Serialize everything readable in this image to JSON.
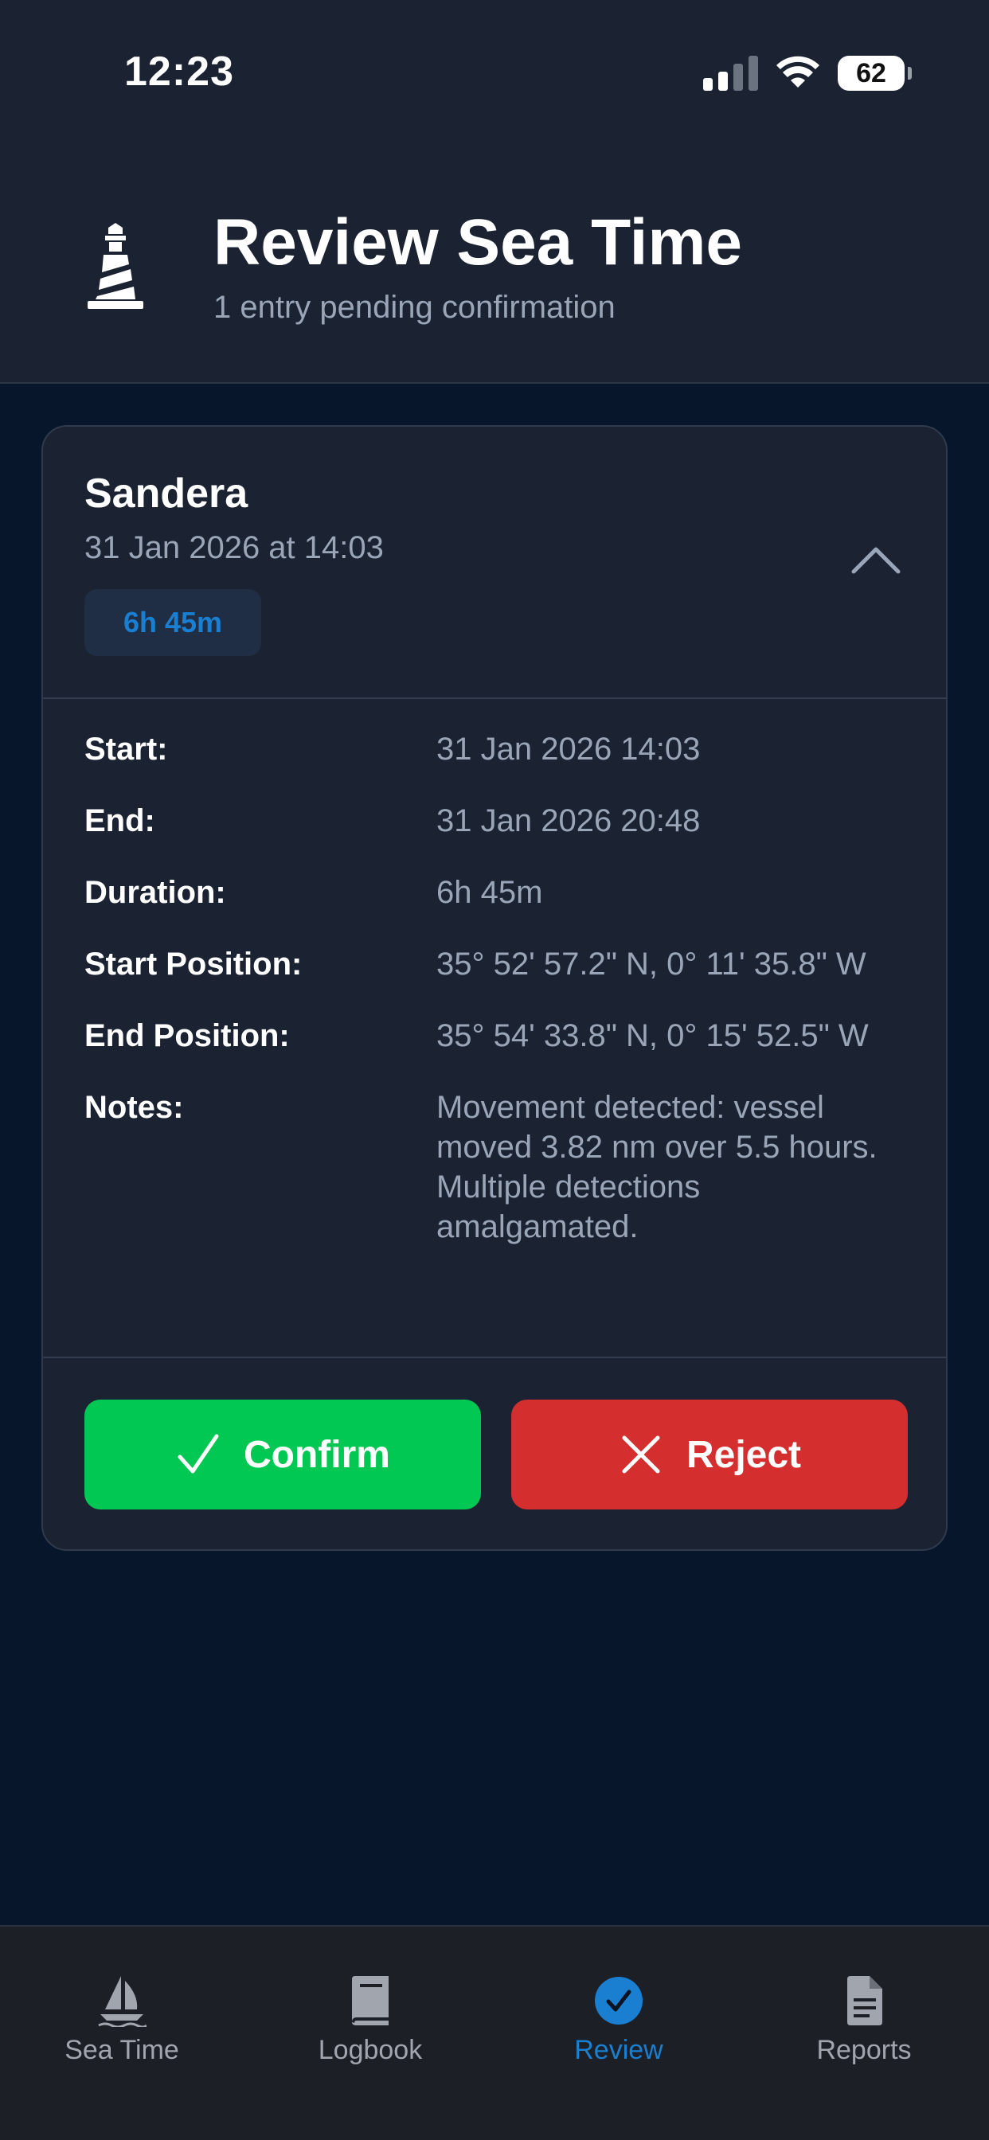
{
  "status_bar": {
    "time": "12:23",
    "battery": "62"
  },
  "header": {
    "title": "Review Sea Time",
    "subtitle": "1 entry pending confirmation"
  },
  "entry": {
    "vessel": "Sandera",
    "date": "31 Jan 2026 at 14:03",
    "duration_badge": "6h 45m",
    "details": [
      {
        "label": "Start:",
        "value": "31 Jan 2026 14:03"
      },
      {
        "label": "End:",
        "value": "31 Jan 2026 20:48"
      },
      {
        "label": "Duration:",
        "value": "6h 45m"
      },
      {
        "label": "Start Position:",
        "value": "35° 52' 57.2\" N, 0° 11' 35.8\" W"
      },
      {
        "label": "End Position:",
        "value": "35° 54' 33.8\" N, 0° 15' 52.5\" W"
      },
      {
        "label": "Notes:",
        "value": "Movement detected: vessel moved 3.82 nm over 5.5 hours. Multiple detections amalgamated."
      }
    ],
    "confirm_label": "Confirm",
    "reject_label": "Reject"
  },
  "tabs": [
    {
      "label": "Sea Time",
      "icon": "sailboat-icon",
      "active": false
    },
    {
      "label": "Logbook",
      "icon": "book-icon",
      "active": false
    },
    {
      "label": "Review",
      "icon": "check-circle-icon",
      "active": true
    },
    {
      "label": "Reports",
      "icon": "document-icon",
      "active": false
    }
  ],
  "colors": {
    "accent": "#1a7fd0",
    "confirm": "#00c853",
    "reject": "#d42e2e",
    "card": "#1b2333",
    "background": "#07162a"
  }
}
